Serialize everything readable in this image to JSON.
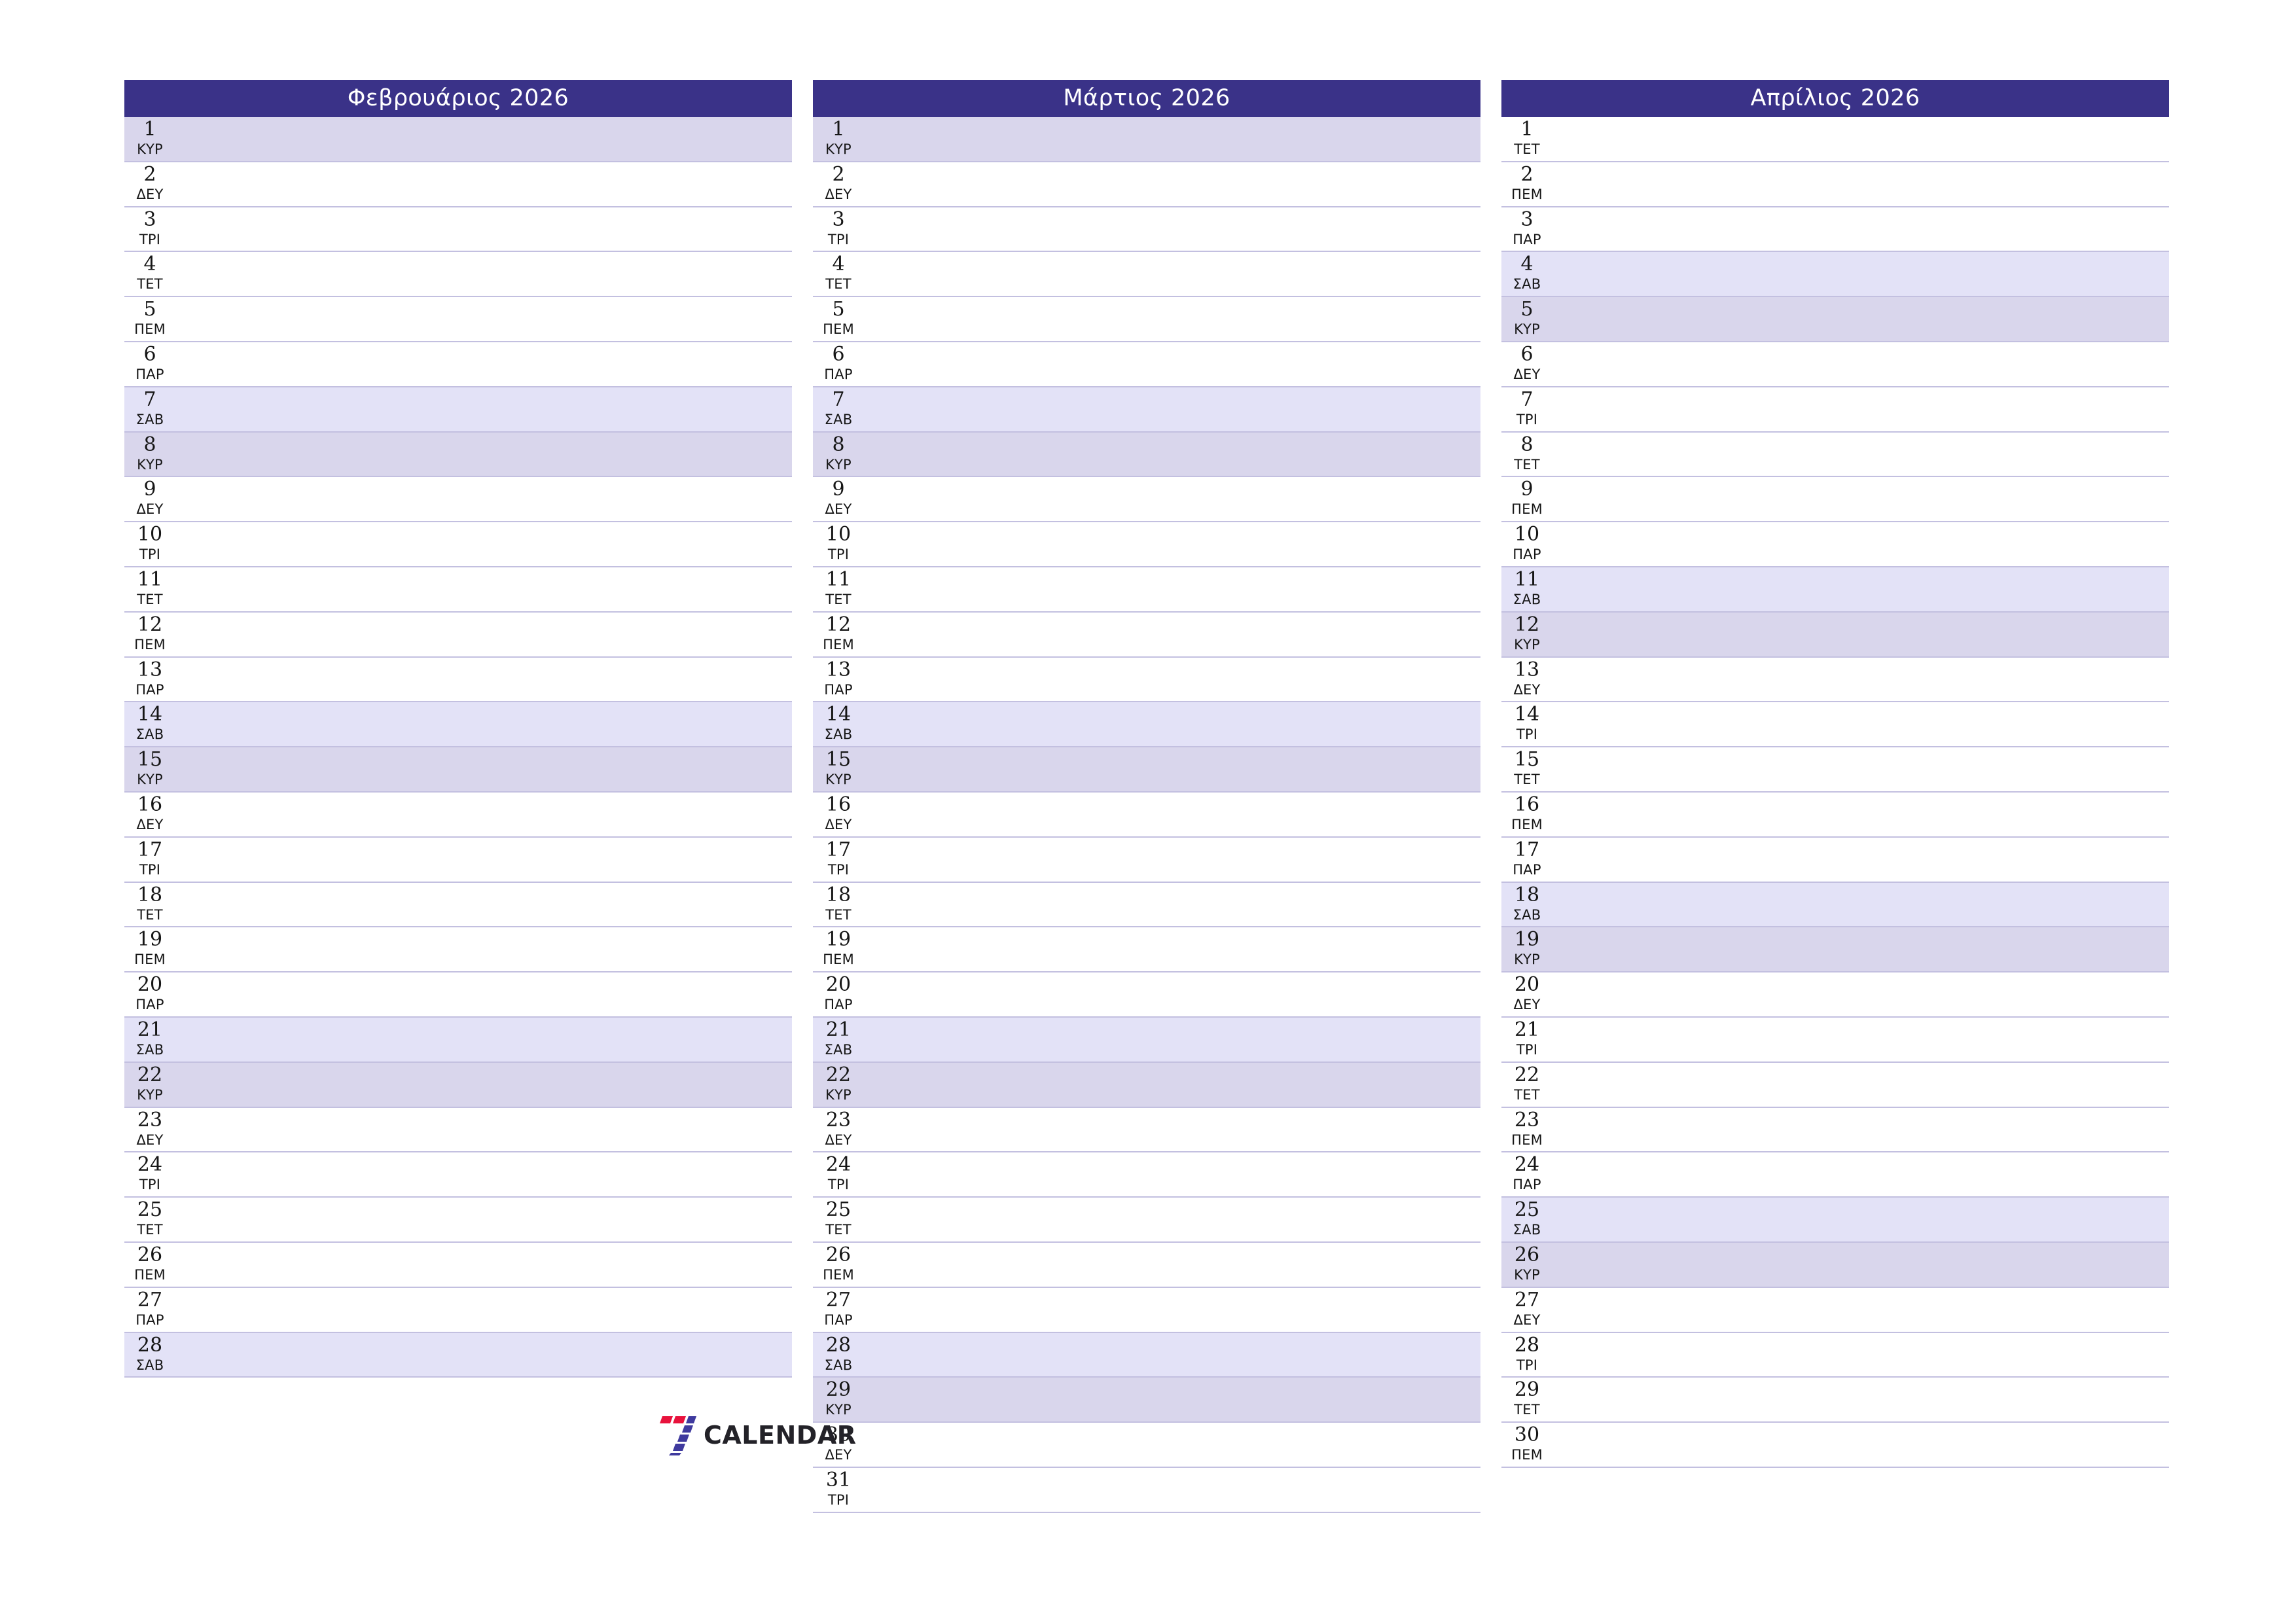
{
  "brand": {
    "name": "CALENDAR",
    "mark_icon": "seven-logo-icon",
    "mark_colors": {
      "red": "#e8123c",
      "blue": "#3f3a9e"
    }
  },
  "theme": {
    "header_bg": "#3a3288",
    "header_text": "#ffffff",
    "saturday_bg": "#e3e2f7",
    "sunday_bg": "#d9d6ec",
    "row_border": "#c3c0e0",
    "page_bg": "#ffffff",
    "day_text": "#161616"
  },
  "weekday_abbr": {
    "mon": "ΔΕΥ",
    "tue": "ΤΡΙ",
    "wed": "ΤΕΤ",
    "thu": "ΠΕΜ",
    "fri": "ΠΑΡ",
    "sat": "ΣΑΒ",
    "sun": "ΚΥΡ"
  },
  "months": [
    {
      "title": "Φεβρουάριος 2026",
      "days": [
        {
          "num": "1",
          "abbr": "ΚΥΡ",
          "type": "sun"
        },
        {
          "num": "2",
          "abbr": "ΔΕΥ",
          "type": ""
        },
        {
          "num": "3",
          "abbr": "ΤΡΙ",
          "type": ""
        },
        {
          "num": "4",
          "abbr": "ΤΕΤ",
          "type": ""
        },
        {
          "num": "5",
          "abbr": "ΠΕΜ",
          "type": ""
        },
        {
          "num": "6",
          "abbr": "ΠΑΡ",
          "type": ""
        },
        {
          "num": "7",
          "abbr": "ΣΑΒ",
          "type": "sat"
        },
        {
          "num": "8",
          "abbr": "ΚΥΡ",
          "type": "sun"
        },
        {
          "num": "9",
          "abbr": "ΔΕΥ",
          "type": ""
        },
        {
          "num": "10",
          "abbr": "ΤΡΙ",
          "type": ""
        },
        {
          "num": "11",
          "abbr": "ΤΕΤ",
          "type": ""
        },
        {
          "num": "12",
          "abbr": "ΠΕΜ",
          "type": ""
        },
        {
          "num": "13",
          "abbr": "ΠΑΡ",
          "type": ""
        },
        {
          "num": "14",
          "abbr": "ΣΑΒ",
          "type": "sat"
        },
        {
          "num": "15",
          "abbr": "ΚΥΡ",
          "type": "sun"
        },
        {
          "num": "16",
          "abbr": "ΔΕΥ",
          "type": ""
        },
        {
          "num": "17",
          "abbr": "ΤΡΙ",
          "type": ""
        },
        {
          "num": "18",
          "abbr": "ΤΕΤ",
          "type": ""
        },
        {
          "num": "19",
          "abbr": "ΠΕΜ",
          "type": ""
        },
        {
          "num": "20",
          "abbr": "ΠΑΡ",
          "type": ""
        },
        {
          "num": "21",
          "abbr": "ΣΑΒ",
          "type": "sat"
        },
        {
          "num": "22",
          "abbr": "ΚΥΡ",
          "type": "sun"
        },
        {
          "num": "23",
          "abbr": "ΔΕΥ",
          "type": ""
        },
        {
          "num": "24",
          "abbr": "ΤΡΙ",
          "type": ""
        },
        {
          "num": "25",
          "abbr": "ΤΕΤ",
          "type": ""
        },
        {
          "num": "26",
          "abbr": "ΠΕΜ",
          "type": ""
        },
        {
          "num": "27",
          "abbr": "ΠΑΡ",
          "type": ""
        },
        {
          "num": "28",
          "abbr": "ΣΑΒ",
          "type": "sat"
        }
      ]
    },
    {
      "title": "Μάρτιος 2026",
      "days": [
        {
          "num": "1",
          "abbr": "ΚΥΡ",
          "type": "sun"
        },
        {
          "num": "2",
          "abbr": "ΔΕΥ",
          "type": ""
        },
        {
          "num": "3",
          "abbr": "ΤΡΙ",
          "type": ""
        },
        {
          "num": "4",
          "abbr": "ΤΕΤ",
          "type": ""
        },
        {
          "num": "5",
          "abbr": "ΠΕΜ",
          "type": ""
        },
        {
          "num": "6",
          "abbr": "ΠΑΡ",
          "type": ""
        },
        {
          "num": "7",
          "abbr": "ΣΑΒ",
          "type": "sat"
        },
        {
          "num": "8",
          "abbr": "ΚΥΡ",
          "type": "sun"
        },
        {
          "num": "9",
          "abbr": "ΔΕΥ",
          "type": ""
        },
        {
          "num": "10",
          "abbr": "ΤΡΙ",
          "type": ""
        },
        {
          "num": "11",
          "abbr": "ΤΕΤ",
          "type": ""
        },
        {
          "num": "12",
          "abbr": "ΠΕΜ",
          "type": ""
        },
        {
          "num": "13",
          "abbr": "ΠΑΡ",
          "type": ""
        },
        {
          "num": "14",
          "abbr": "ΣΑΒ",
          "type": "sat"
        },
        {
          "num": "15",
          "abbr": "ΚΥΡ",
          "type": "sun"
        },
        {
          "num": "16",
          "abbr": "ΔΕΥ",
          "type": ""
        },
        {
          "num": "17",
          "abbr": "ΤΡΙ",
          "type": ""
        },
        {
          "num": "18",
          "abbr": "ΤΕΤ",
          "type": ""
        },
        {
          "num": "19",
          "abbr": "ΠΕΜ",
          "type": ""
        },
        {
          "num": "20",
          "abbr": "ΠΑΡ",
          "type": ""
        },
        {
          "num": "21",
          "abbr": "ΣΑΒ",
          "type": "sat"
        },
        {
          "num": "22",
          "abbr": "ΚΥΡ",
          "type": "sun"
        },
        {
          "num": "23",
          "abbr": "ΔΕΥ",
          "type": ""
        },
        {
          "num": "24",
          "abbr": "ΤΡΙ",
          "type": ""
        },
        {
          "num": "25",
          "abbr": "ΤΕΤ",
          "type": ""
        },
        {
          "num": "26",
          "abbr": "ΠΕΜ",
          "type": ""
        },
        {
          "num": "27",
          "abbr": "ΠΑΡ",
          "type": ""
        },
        {
          "num": "28",
          "abbr": "ΣΑΒ",
          "type": "sat"
        },
        {
          "num": "29",
          "abbr": "ΚΥΡ",
          "type": "sun"
        },
        {
          "num": "30",
          "abbr": "ΔΕΥ",
          "type": ""
        },
        {
          "num": "31",
          "abbr": "ΤΡΙ",
          "type": ""
        }
      ]
    },
    {
      "title": "Απρίλιος 2026",
      "days": [
        {
          "num": "1",
          "abbr": "ΤΕΤ",
          "type": ""
        },
        {
          "num": "2",
          "abbr": "ΠΕΜ",
          "type": ""
        },
        {
          "num": "3",
          "abbr": "ΠΑΡ",
          "type": ""
        },
        {
          "num": "4",
          "abbr": "ΣΑΒ",
          "type": "sat"
        },
        {
          "num": "5",
          "abbr": "ΚΥΡ",
          "type": "sun"
        },
        {
          "num": "6",
          "abbr": "ΔΕΥ",
          "type": ""
        },
        {
          "num": "7",
          "abbr": "ΤΡΙ",
          "type": ""
        },
        {
          "num": "8",
          "abbr": "ΤΕΤ",
          "type": ""
        },
        {
          "num": "9",
          "abbr": "ΠΕΜ",
          "type": ""
        },
        {
          "num": "10",
          "abbr": "ΠΑΡ",
          "type": ""
        },
        {
          "num": "11",
          "abbr": "ΣΑΒ",
          "type": "sat"
        },
        {
          "num": "12",
          "abbr": "ΚΥΡ",
          "type": "sun"
        },
        {
          "num": "13",
          "abbr": "ΔΕΥ",
          "type": ""
        },
        {
          "num": "14",
          "abbr": "ΤΡΙ",
          "type": ""
        },
        {
          "num": "15",
          "abbr": "ΤΕΤ",
          "type": ""
        },
        {
          "num": "16",
          "abbr": "ΠΕΜ",
          "type": ""
        },
        {
          "num": "17",
          "abbr": "ΠΑΡ",
          "type": ""
        },
        {
          "num": "18",
          "abbr": "ΣΑΒ",
          "type": "sat"
        },
        {
          "num": "19",
          "abbr": "ΚΥΡ",
          "type": "sun"
        },
        {
          "num": "20",
          "abbr": "ΔΕΥ",
          "type": ""
        },
        {
          "num": "21",
          "abbr": "ΤΡΙ",
          "type": ""
        },
        {
          "num": "22",
          "abbr": "ΤΕΤ",
          "type": ""
        },
        {
          "num": "23",
          "abbr": "ΠΕΜ",
          "type": ""
        },
        {
          "num": "24",
          "abbr": "ΠΑΡ",
          "type": ""
        },
        {
          "num": "25",
          "abbr": "ΣΑΒ",
          "type": "sat"
        },
        {
          "num": "26",
          "abbr": "ΚΥΡ",
          "type": "sun"
        },
        {
          "num": "27",
          "abbr": "ΔΕΥ",
          "type": ""
        },
        {
          "num": "28",
          "abbr": "ΤΡΙ",
          "type": ""
        },
        {
          "num": "29",
          "abbr": "ΤΕΤ",
          "type": ""
        },
        {
          "num": "30",
          "abbr": "ΠΕΜ",
          "type": ""
        }
      ]
    }
  ]
}
